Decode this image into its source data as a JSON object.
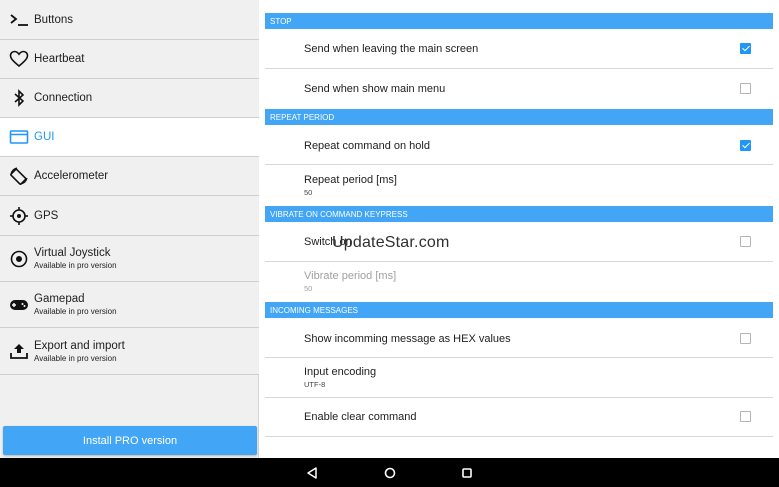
{
  "sidebar": {
    "items": [
      {
        "label": "Buttons",
        "icon": "terminal-icon"
      },
      {
        "label": "Heartbeat",
        "icon": "heart-icon"
      },
      {
        "label": "Connection",
        "icon": "bluetooth-icon"
      },
      {
        "label": "GUI",
        "icon": "screen-icon",
        "active": true
      },
      {
        "label": "Accelerometer",
        "icon": "screen-rotation-icon"
      },
      {
        "label": "GPS",
        "icon": "gps-crosshair-icon"
      },
      {
        "label": "Virtual Joystick",
        "sub": "Available in pro version",
        "icon": "joystick-icon"
      },
      {
        "label": "Gamepad",
        "sub": "Available in pro version",
        "icon": "gamepad-icon"
      },
      {
        "label": "Export and import",
        "sub": "Available in pro version",
        "icon": "upload-icon"
      }
    ],
    "pro_button": "Install PRO version"
  },
  "settings": {
    "stop": {
      "header": "STOP",
      "send_leaving": {
        "title": "Send when leaving the main screen",
        "checked": true
      },
      "send_menu": {
        "title": "Send when show main menu",
        "checked": false
      }
    },
    "repeat": {
      "header": "REPEAT PERIOD",
      "repeat_hold": {
        "title": "Repeat command on hold",
        "checked": true
      },
      "repeat_period": {
        "title": "Repeat period [ms]",
        "value": "50"
      }
    },
    "vibrate": {
      "header": "VIBRATE ON COMMAND KEYPRESS",
      "switch_on": {
        "title": "Switch on",
        "checked": false
      },
      "vibrate_period": {
        "title": "Vibrate period [ms]",
        "value": "50"
      }
    },
    "incoming": {
      "header": "INCOMING MESSAGES",
      "hex": {
        "title": "Show incomming message as HEX values",
        "checked": false
      },
      "encoding": {
        "title": "Input encoding",
        "value": "UTF-8"
      },
      "clear": {
        "title": "Enable clear command",
        "checked": false
      }
    }
  },
  "watermark": "UpdateStar.com",
  "navbar": {
    "back": "back-icon",
    "home": "home-icon",
    "recents": "recents-icon"
  },
  "colors": {
    "accent": "#2196f3",
    "header": "#42a5f5",
    "sidebar_bg": "#f0f0f0"
  }
}
